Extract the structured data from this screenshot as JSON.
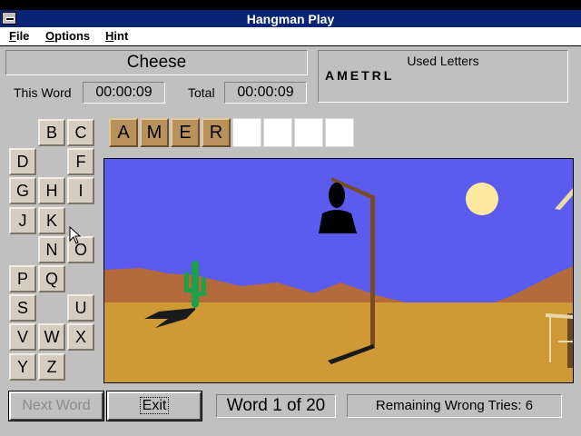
{
  "window": {
    "title": "Hangman Play"
  },
  "menu": [
    {
      "label": "File",
      "accel": "F"
    },
    {
      "label": "Options",
      "accel": "O"
    },
    {
      "label": "Hint",
      "accel": "H"
    }
  ],
  "category": "Cheese",
  "timers": {
    "this_word_label": "This Word",
    "this_word_value": "00:00:09",
    "total_label": "Total",
    "total_value": "00:00:09"
  },
  "used": {
    "title": "Used Letters",
    "letters": "AMETRL"
  },
  "alphabet": [
    {
      "letter": "B",
      "row": 0,
      "col": 1
    },
    {
      "letter": "C",
      "row": 0,
      "col": 2
    },
    {
      "letter": "D",
      "row": 1,
      "col": 0
    },
    {
      "letter": "F",
      "row": 1,
      "col": 2
    },
    {
      "letter": "G",
      "row": 2,
      "col": 0
    },
    {
      "letter": "H",
      "row": 2,
      "col": 1
    },
    {
      "letter": "I",
      "row": 2,
      "col": 2
    },
    {
      "letter": "J",
      "row": 3,
      "col": 0
    },
    {
      "letter": "K",
      "row": 3,
      "col": 1
    },
    {
      "letter": "N",
      "row": 4,
      "col": 1
    },
    {
      "letter": "O",
      "row": 4,
      "col": 2
    },
    {
      "letter": "P",
      "row": 5,
      "col": 0
    },
    {
      "letter": "Q",
      "row": 5,
      "col": 1
    },
    {
      "letter": "S",
      "row": 6,
      "col": 0
    },
    {
      "letter": "U",
      "row": 6,
      "col": 2
    },
    {
      "letter": "V",
      "row": 7,
      "col": 0
    },
    {
      "letter": "W",
      "row": 7,
      "col": 1
    },
    {
      "letter": "X",
      "row": 7,
      "col": 2
    },
    {
      "letter": "Y",
      "row": 8,
      "col": 0
    },
    {
      "letter": "Z",
      "row": 8,
      "col": 1
    }
  ],
  "word_slots": [
    "A",
    "M",
    "E",
    "R",
    "",
    "",
    "",
    ""
  ],
  "buttons": {
    "next_word": "Next Word",
    "exit": "Exit"
  },
  "status": {
    "word_progress": "Word 1 of 20",
    "remaining": "Remaining Wrong Tries: 6"
  },
  "colors": {
    "sky": "#5b5bf0",
    "sand": "#cf9a36",
    "mountains": "#b56a3c",
    "cactus": "#1ca14a",
    "sun": "#ffe8a0",
    "gallows": "#7a4a23"
  }
}
